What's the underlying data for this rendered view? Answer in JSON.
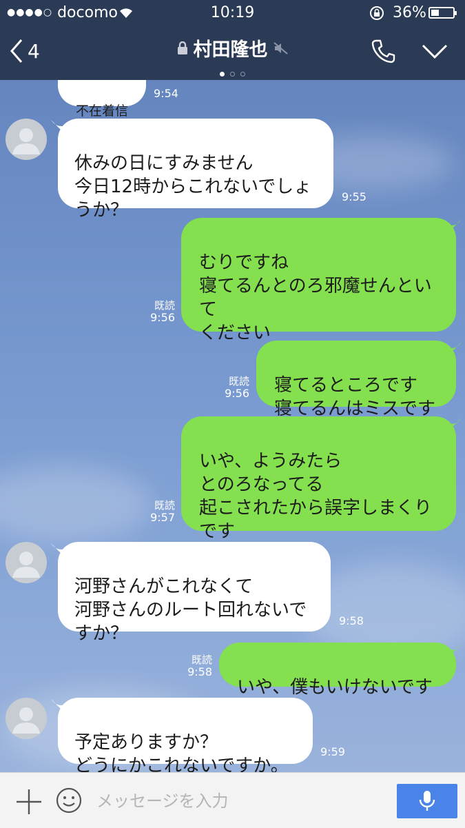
{
  "status_bar": {
    "signal_dots": "●●●●○",
    "carrier": "docomo",
    "time": "10:19",
    "battery_percent": "36%",
    "battery_level": 0.36
  },
  "header": {
    "back_count": "4",
    "title": "村田隆也",
    "page_count": 3,
    "active_page": 0
  },
  "messages": [
    {
      "side": "in",
      "text": "不在着信",
      "time": "9:54",
      "read": ""
    },
    {
      "side": "in",
      "text": "休みの日にすみません\n今日12時からこれないでしょ\nうか？",
      "time": "9:55",
      "read": ""
    },
    {
      "side": "out",
      "text": "むりですね\n寝てるんとのろ邪魔せんとい\nて\nください",
      "time": "9:56",
      "read": "既読"
    },
    {
      "side": "out",
      "text": "寝てるところです\n寝てるんはミスです",
      "time": "9:56",
      "read": "既読"
    },
    {
      "side": "out",
      "text": "いや、ようみたら\nとのろなってる\n起こされたから誤字しまくり\nです",
      "time": "9:57",
      "read": "既読"
    },
    {
      "side": "in",
      "text": "河野さんがこれなくて\n河野さんのルート回れないで\nすか？",
      "time": "9:58",
      "read": ""
    },
    {
      "side": "out",
      "text": "いや、僕もいけないです",
      "time": "9:58",
      "read": "既読"
    },
    {
      "side": "in",
      "text": "予定ありますか？\nどうにかこれないですか。",
      "time": "9:59",
      "read": ""
    }
  ],
  "input": {
    "placeholder": "メッセージを入力"
  },
  "colors": {
    "header_bg": "#2b3a55",
    "outgoing_bubble": "#84e04e",
    "incoming_bubble": "#ffffff",
    "mic_button": "#4a84e8"
  }
}
